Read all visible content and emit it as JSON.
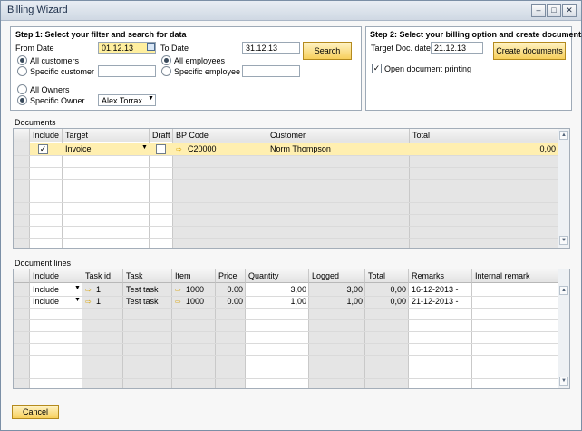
{
  "window": {
    "title": "Billing Wizard",
    "minimize": "–",
    "maximize": "□",
    "close": "✕"
  },
  "step1": {
    "heading": "Step 1: Select your filter and search for data",
    "from_date_label": "From Date",
    "from_date": "01.12.13",
    "to_date_label": "To Date",
    "to_date": "31.12.13",
    "search_label": "Search",
    "all_customers": "All customers",
    "specific_customer": "Specific customer",
    "all_employees": "All employees",
    "specific_employee": "Specific employee",
    "all_owners": "All Owners",
    "specific_owner": "Specific Owner",
    "owner_value": "Alex Torrax"
  },
  "step2": {
    "heading": "Step 2: Select your billing option and create documents",
    "target_date_label": "Target Doc. date",
    "target_date": "21.12.13",
    "create_label": "Create documents",
    "open_printing_label": "Open document printing"
  },
  "documents": {
    "label": "Documents",
    "columns": [
      "Include",
      "Target",
      "Draft",
      "BP Code",
      "Customer",
      "Total"
    ],
    "row": {
      "target": "Invoice",
      "bp_code": "C20000",
      "customer": "Norm Thompson",
      "total": "0,00"
    }
  },
  "lines": {
    "label": "Document lines",
    "columns": [
      "Include",
      "Task id",
      "Task",
      "Item",
      "Price",
      "Quantity",
      "Logged",
      "Total",
      "Remarks",
      "Internal remark"
    ],
    "rows": [
      {
        "include": "Include",
        "task_id": "1",
        "task": "Test task",
        "item": "1000",
        "price": "0.00",
        "quantity": "3,00",
        "logged": "3,00",
        "total": "0,00",
        "remarks": "16-12-2013 -"
      },
      {
        "include": "Include",
        "task_id": "1",
        "task": "Test task",
        "item": "1000",
        "price": "0.00",
        "quantity": "1,00",
        "logged": "1,00",
        "total": "0,00",
        "remarks": "21-12-2013 -"
      }
    ]
  },
  "cancel_label": "Cancel",
  "colors": {
    "accent": "#f7cf5b",
    "selected_row": "#ffefb0"
  }
}
